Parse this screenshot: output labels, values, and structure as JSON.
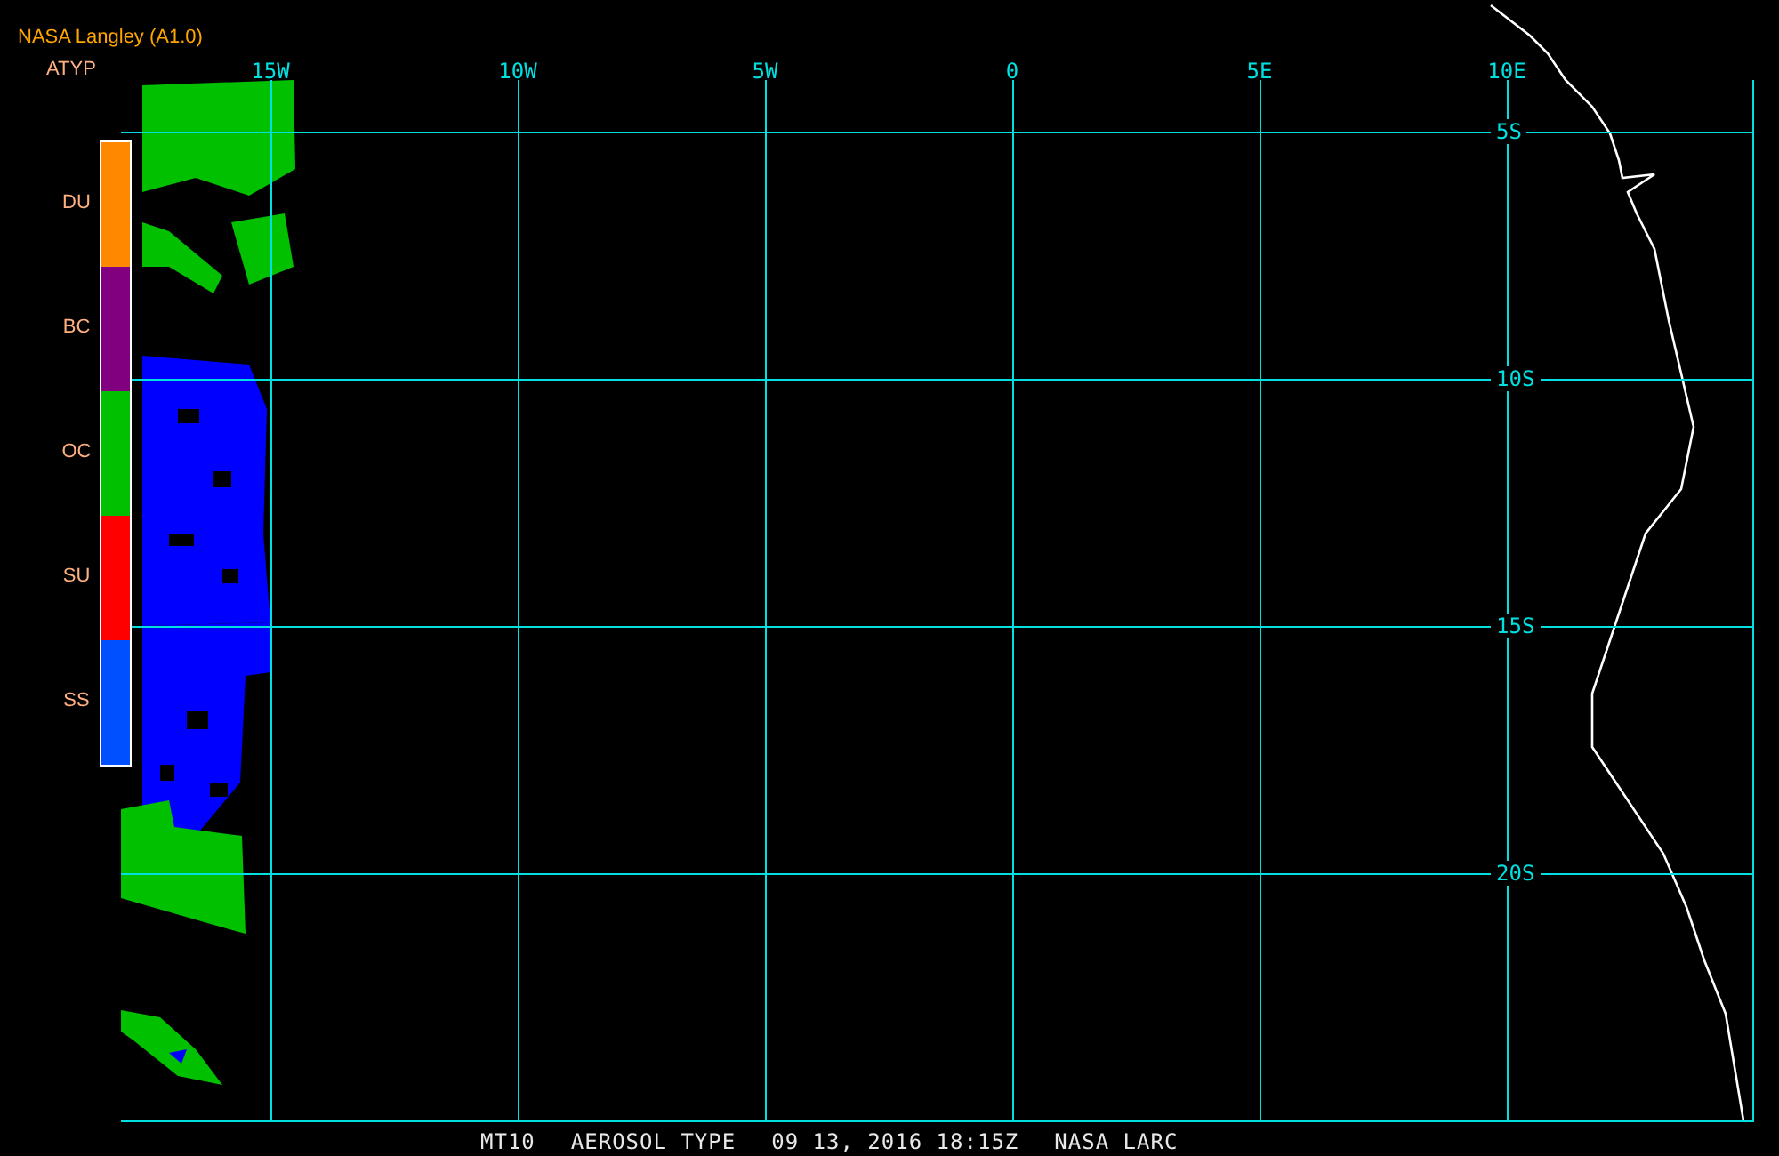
{
  "header": {
    "title": "NASA Langley (A1.0)",
    "product": "ATYP"
  },
  "legend": [
    {
      "label": "DU",
      "color": "#ff8800"
    },
    {
      "label": "BC",
      "color": "#800080"
    },
    {
      "label": "OC",
      "color": "#00c000"
    },
    {
      "label": "SU",
      "color": "#ff0000"
    },
    {
      "label": "SS",
      "color": "#0050ff"
    }
  ],
  "map": {
    "kind": "picture",
    "longitude_labels": [
      "15W",
      "10W",
      "5W",
      "0",
      "5E",
      "10E"
    ],
    "latitude_labels": [
      "5S",
      "10S",
      "15S",
      "20S"
    ]
  },
  "footer": [
    "MT10",
    "AEROSOL TYPE",
    "09 13, 2016 18:15Z",
    "NASA LARC"
  ]
}
